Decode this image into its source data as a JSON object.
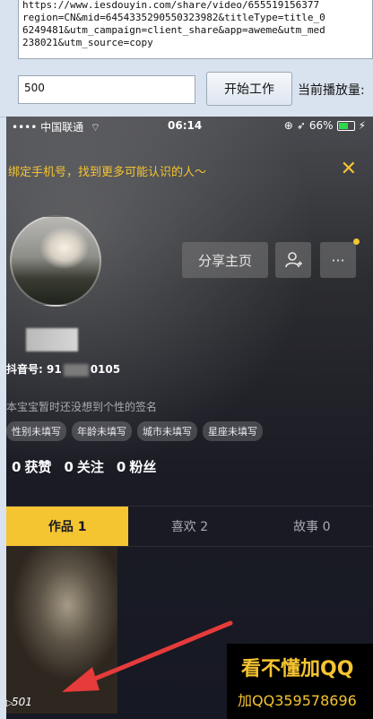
{
  "tool": {
    "url_text": "https://www.iesdouyin.com/share/video/655519156377\nregion=CN&mid=6454335290550323982&titleType=title_0\n6249481&utm_campaign=client_share&app=aweme&utm_med\n238021&utm_source=copy",
    "count_value": "500",
    "start_button": "开始工作",
    "play_count_label": "当前播放量:"
  },
  "phone": {
    "status": {
      "carrier": "•••• 中国联通",
      "wifi_icon": "wifi-icon",
      "time": "06:14",
      "battery": "66%"
    },
    "banner": {
      "text": "绑定手机号，找到更多可能认识的人～",
      "close": "✕"
    },
    "profile": {
      "share_label": "分享主页",
      "add_friend_icon": "add-friend-icon",
      "more_label": "···",
      "douyin_id_prefix": "抖音号: 91",
      "douyin_id_suffix": "0105",
      "signature": "本宝宝暂时还没想到个性的签名",
      "tags": [
        "性别未填写",
        "年龄未填写",
        "城市未填写",
        "星座未填写"
      ],
      "stats": [
        {
          "num": "0",
          "label": "获赞"
        },
        {
          "num": "0",
          "label": "关注"
        },
        {
          "num": "0",
          "label": "粉丝"
        }
      ]
    },
    "tabs": [
      {
        "label": "作品 1"
      },
      {
        "label": "喜欢 2"
      },
      {
        "label": "故事 0"
      }
    ],
    "video": {
      "count": "501"
    },
    "watermark": {
      "line1": "看不懂加QQ",
      "line2": "加QQ359578696"
    }
  },
  "colors": {
    "accent": "#f5c431",
    "arrow": "#e53b3b"
  }
}
